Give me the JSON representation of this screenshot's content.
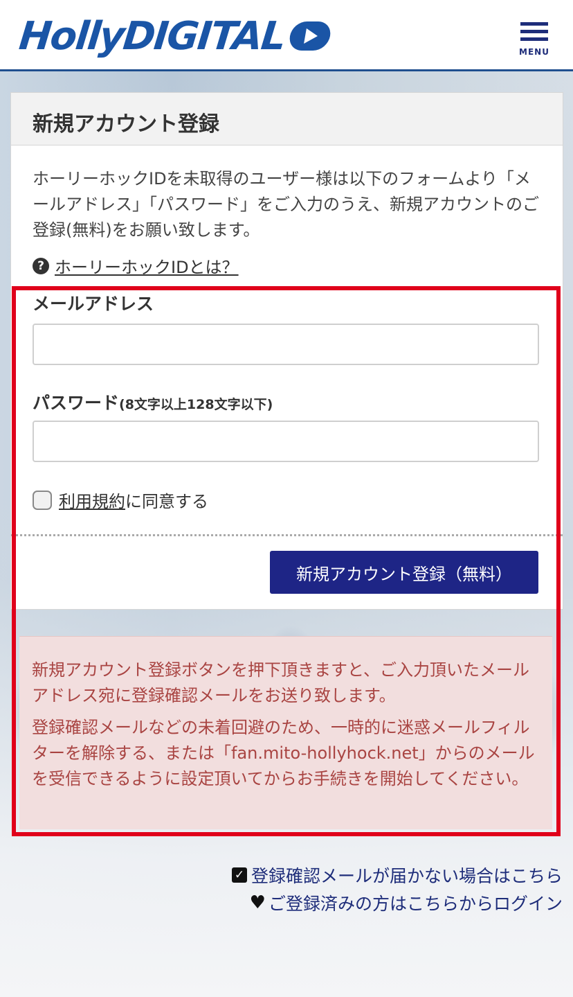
{
  "header": {
    "logo_text": "HollyDIGITAL",
    "menu_label": "MENU"
  },
  "card": {
    "title": "新規アカウント登録",
    "intro": "ホーリーホックIDを未取得のユーザー様は以下のフォームより「メールアドレス」「パスワード」をご入力のうえ、新規アカウントのご登録(無料)をお願い致します。",
    "help_link": "ホーリーホックIDとは？",
    "email_label": "メールアドレス",
    "email_value": "",
    "password_label": "パスワード",
    "password_note": "(8文字以上128文字以下)",
    "password_value": "",
    "terms_link": "利用規約",
    "terms_suffix": "に同意する",
    "submit_label": "新規アカウント登録（無料）"
  },
  "notice": {
    "p1": "新規アカウント登録ボタンを押下頂きますと、ご入力頂いたメールアドレス宛に登録確認メールをお送り致します。",
    "p2": "登録確認メールなどの未着回避のため、一時的に迷惑メールフィルターを解除する、または「fan.mito-hollyhock.net」からのメールを受信できるように設定頂いてからお手続きを開始してください。"
  },
  "links": {
    "not_received": "登録確認メールが届かない場合はこちら",
    "login": "ご登録済みの方はこちらからログイン"
  },
  "icons": {
    "help": "question-circle-icon",
    "check": "check-square-icon",
    "heart": "heart-icon"
  },
  "colors": {
    "brand": "#1a55a6",
    "button": "#1e2586",
    "highlight": "#e0001b",
    "notice_bg": "#f2dede",
    "notice_text": "#a94442"
  }
}
